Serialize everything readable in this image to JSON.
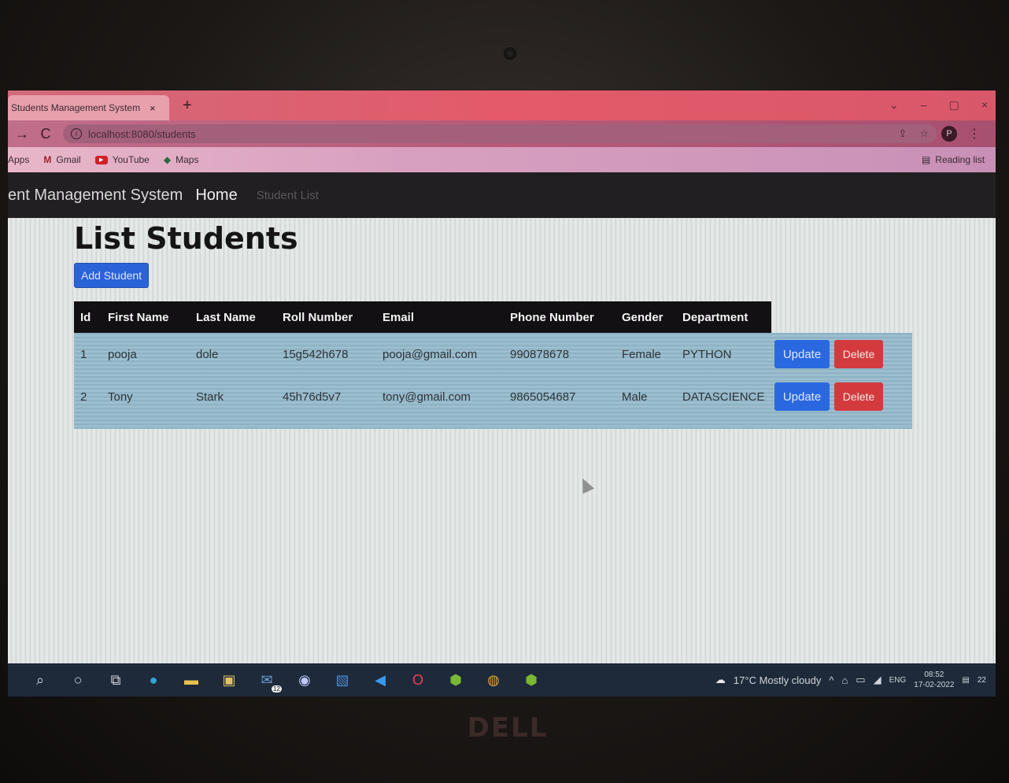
{
  "browser": {
    "tab_title": "Students Management System",
    "tab_close": "×",
    "new_tab": "+",
    "url": "localhost:8080/students",
    "window_controls": [
      "⌄",
      "–",
      "▢",
      "×"
    ],
    "bookmarks": [
      {
        "label": "Apps",
        "icon": "apps-icon"
      },
      {
        "label": "Gmail",
        "icon": "gmail-icon"
      },
      {
        "label": "YouTube",
        "icon": "youtube-icon"
      },
      {
        "label": "Maps",
        "icon": "maps-icon"
      }
    ],
    "reading_list": "Reading list",
    "profile_initial": "P"
  },
  "app": {
    "brand": "ent Management System",
    "nav_home": "Home",
    "nav_student_list": "Student List",
    "page_title": "List Students",
    "add_button": "Add Student"
  },
  "table": {
    "columns": [
      "Id",
      "First Name",
      "Last Name",
      "Roll Number",
      "Email",
      "Phone Number",
      "Gender",
      "Department"
    ],
    "rows": [
      {
        "id": "1",
        "first_name": "pooja",
        "last_name": "dole",
        "roll_number": "15g542h678",
        "email": "pooja@gmail.com",
        "phone": "990878678",
        "gender": "Female",
        "department": "PYTHON",
        "update": "Update",
        "delete": "Delete"
      },
      {
        "id": "2",
        "first_name": "Tony",
        "last_name": "Stark",
        "roll_number": "45h76d5v7",
        "email": "tony@gmail.com",
        "phone": "9865054687",
        "gender": "Male",
        "department": "DATASCIENCE",
        "update": "Update",
        "delete": "Delete"
      }
    ]
  },
  "taskbar": {
    "mail_badge": "12",
    "weather": "17°C  Mostly cloudy",
    "language": "ENG",
    "time": "08:52",
    "date": "17-02-2022",
    "notification_count": "22"
  },
  "device": {
    "brand": "DELL"
  },
  "colors": {
    "primary_button": "#2a68e0",
    "danger_button": "#d23a3e",
    "navbar": "#221f22",
    "table_header": "#121012"
  }
}
